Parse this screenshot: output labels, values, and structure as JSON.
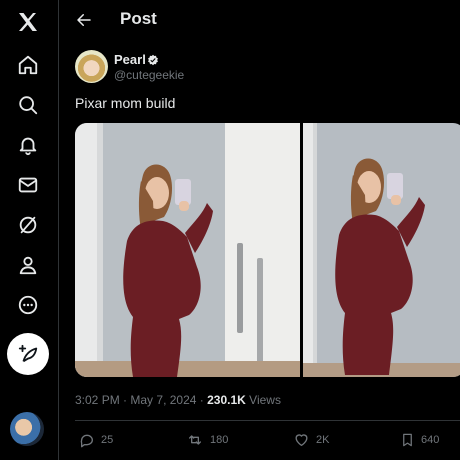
{
  "header": {
    "title": "Post"
  },
  "post": {
    "display_name": "Pearl",
    "handle": "@cutegeekie",
    "text": "Pixar mom build",
    "time": "3:02 PM",
    "separator": "·",
    "date": "May 7, 2024",
    "views_count": "230.1K",
    "views_label": "Views"
  },
  "actions": {
    "replies": "25",
    "reposts": "180",
    "likes": "2K",
    "bookmarks": "640"
  },
  "sidebar": {
    "items": [
      {
        "icon": "x-logo-icon"
      },
      {
        "icon": "home-icon"
      },
      {
        "icon": "search-icon"
      },
      {
        "icon": "bell-icon"
      },
      {
        "icon": "mail-icon"
      },
      {
        "icon": "grok-icon"
      },
      {
        "icon": "profile-icon"
      },
      {
        "icon": "more-icon"
      }
    ]
  },
  "colors": {
    "background": "#000000",
    "text": "#e7e9ea",
    "muted": "#71767b",
    "border": "#2f3336"
  }
}
